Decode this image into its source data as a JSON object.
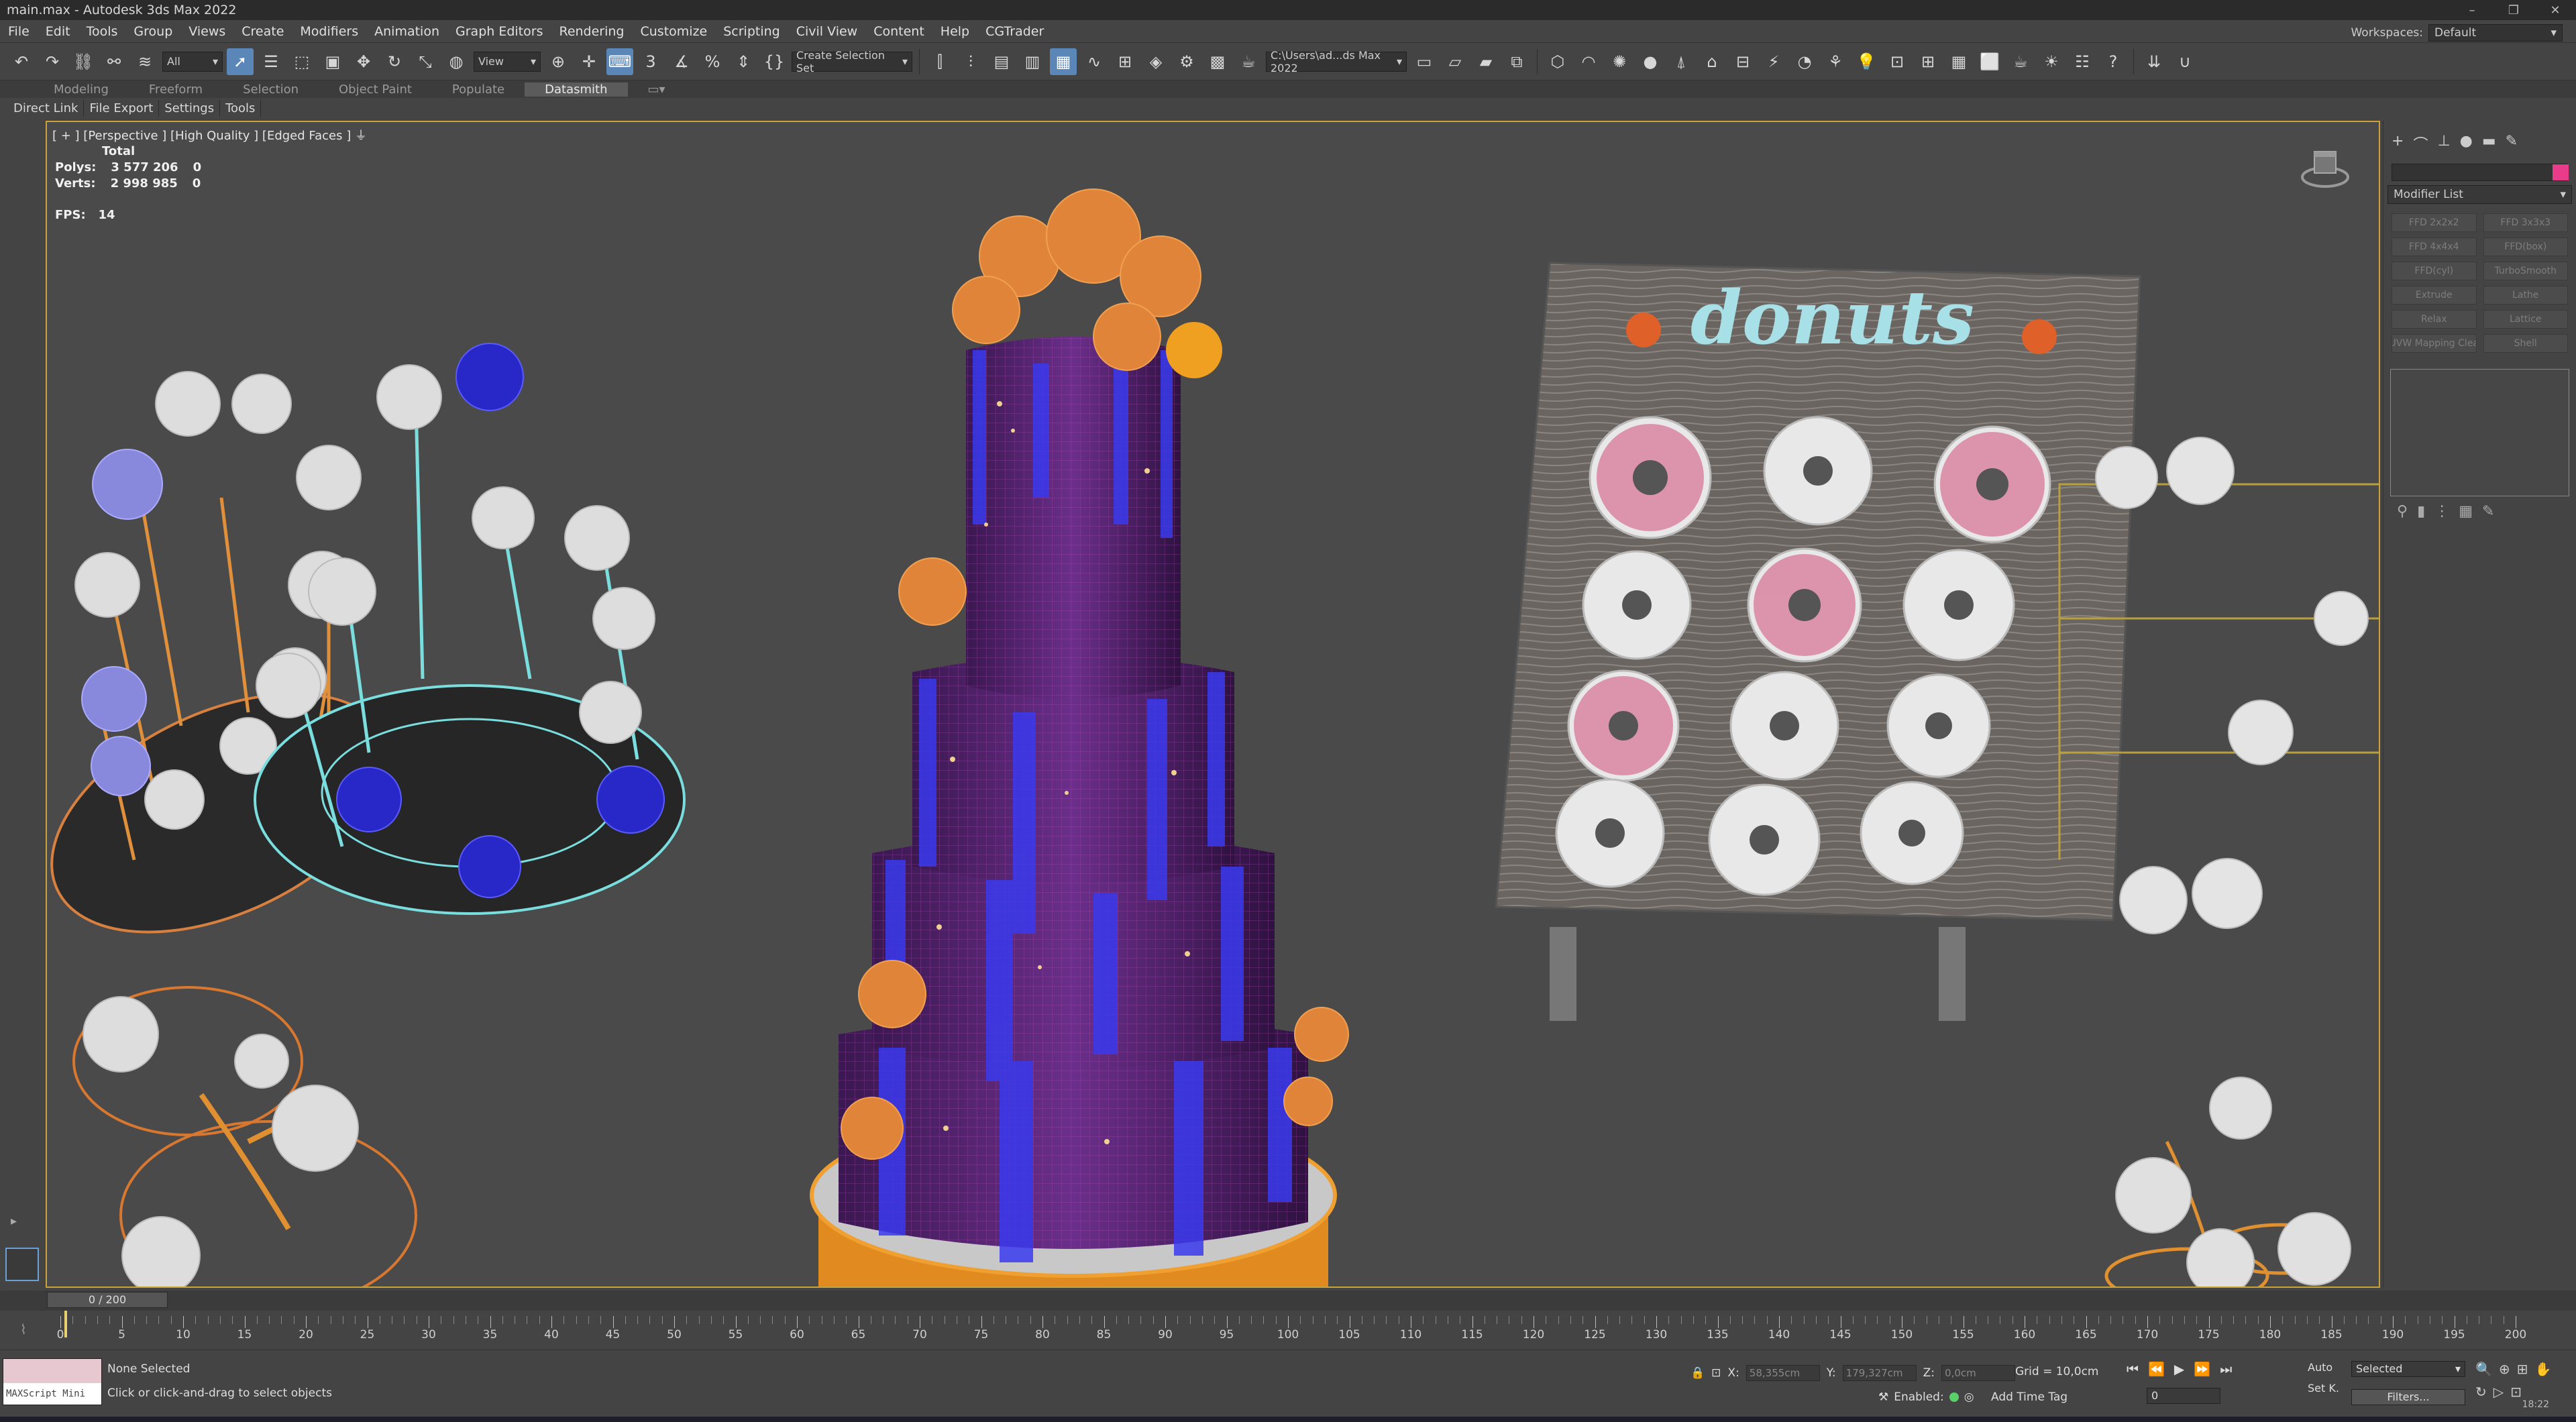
{
  "window": {
    "title": "main.max - Autodesk 3ds Max 2022",
    "controls": [
      "–",
      "❐",
      "✕"
    ]
  },
  "menu": [
    "File",
    "Edit",
    "Tools",
    "Group",
    "Views",
    "Create",
    "Modifiers",
    "Animation",
    "Graph Editors",
    "Rendering",
    "Customize",
    "Scripting",
    "Civil View",
    "Content",
    "Help",
    "CGTrader"
  ],
  "workspace": {
    "label": "Workspaces:",
    "value": "Default"
  },
  "toolbar": {
    "filter_value": "All",
    "refcoord_value": "View",
    "selection_set_placeholder": "Create Selection Set",
    "path_value": "C:\\Users\\ad...ds Max 2022"
  },
  "ribbon": {
    "tabs": [
      "Modeling",
      "Freeform",
      "Selection",
      "Object Paint",
      "Populate",
      "Datasmith"
    ],
    "active": "Datasmith",
    "subtabs": [
      "Direct Link",
      "File Export",
      "Settings",
      "Tools"
    ]
  },
  "viewport": {
    "label": "[ + ] [Perspective ] [High Quality ] [Edged Faces ]",
    "stats_header": "Total",
    "polys_label": "Polys:",
    "polys_value": "3 577 206",
    "polys_sel": "0",
    "verts_label": "Verts:",
    "verts_value": "2 998 985",
    "verts_sel": "0",
    "fps_label": "FPS:",
    "fps_value": "14",
    "sign_text": "donuts"
  },
  "command_panel": {
    "tab_icons": [
      "plus-icon",
      "curve-icon",
      "hierarchy-icon",
      "motion-icon",
      "display-icon",
      "utilities-icon"
    ],
    "modifier_list": "Modifier List",
    "modifier_buttons": [
      "FFD 2x2x2",
      "FFD 3x3x3",
      "FFD 4x4x4",
      "FFD(box)",
      "FFD(cyl)",
      "TurboSmooth",
      "Extrude",
      "Lathe",
      "Relax",
      "Lattice",
      "UVW Mapping Clea",
      "Shell"
    ],
    "swatch_color": "#e83c8a"
  },
  "timeline": {
    "slider_label": "0 / 200",
    "ticks": [
      0,
      5,
      10,
      15,
      20,
      25,
      30,
      35,
      40,
      45,
      50,
      55,
      60,
      65,
      70,
      75,
      80,
      85,
      90,
      95,
      100,
      105,
      110,
      115,
      120,
      125,
      130,
      135,
      140,
      145,
      150,
      155,
      160,
      165,
      170,
      175,
      180,
      185,
      190,
      195,
      200
    ]
  },
  "status": {
    "maxscript_label": "MAXScript Mini",
    "selection": "None Selected",
    "prompt": "Click or click-and-drag to select objects",
    "x_label": "X:",
    "x_value": "58,355cm",
    "y_label": "Y:",
    "y_value": "179,327cm",
    "z_label": "Z:",
    "z_value": "0,0cm",
    "grid": "Grid = 10,0cm",
    "enabled_label": "Enabled:",
    "add_time_tag": "Add Time Tag",
    "frame_value": "0",
    "auto_label": "Auto",
    "setk_label": "Set K.",
    "key_filter_value": "Selected",
    "filters_label": "Filters...",
    "clock": "18:22"
  }
}
